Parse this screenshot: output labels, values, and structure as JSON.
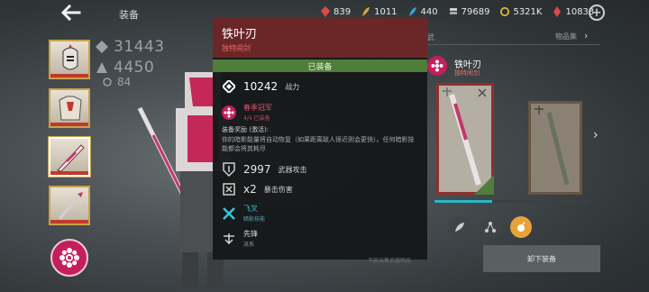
{
  "header": {
    "title": "装备",
    "currencies": [
      {
        "icon": "red-gem-icon",
        "color": "#e04848",
        "value": "839"
      },
      {
        "icon": "gold-feather-icon",
        "color": "#e0a33a",
        "value": "1011"
      },
      {
        "icon": "blue-feather-icon",
        "color": "#3aa0e0",
        "value": "440"
      },
      {
        "icon": "coin-stack-icon",
        "color": "#cfcfcf",
        "value": "79689"
      },
      {
        "icon": "gold-coin-icon",
        "color": "#e8c23a",
        "value": "5321K"
      },
      {
        "icon": "red-shard-icon",
        "color": "#e04848",
        "value": "10833"
      }
    ]
  },
  "left_stats": {
    "power": "31443",
    "rank": "4450",
    "level": "84"
  },
  "tooltip": {
    "name": "铁叶刃",
    "rarity": "独特闹剑",
    "equipped_label": "已装备",
    "power_value": "10242",
    "power_label": "战力",
    "season_name": "春季冠军",
    "season_sub": "4/4 已装备",
    "bonus_title": "装备奖励 (激活):",
    "bonus_text": "你的暗影能量将自动恢复（如果距离敌人很近则会更快）。任何暗影技能都会将其耗尽",
    "attack_value": "2997",
    "attack_label": "武器攻击",
    "crit_value": "x2",
    "crit_label": "暴击伤害",
    "skill_name": "飞叉",
    "skill_sub": "暗影技能",
    "lead_name": "先锋",
    "lead_sub": "派系"
  },
  "right_panel": {
    "tab_left": "武",
    "tab_right": "物品集",
    "item_name": "铁叶刃",
    "item_rarity": "独特闹剑",
    "unequip_label": "卸下装备",
    "footer_hint": "不能出售武器物品"
  },
  "ghost_power": "10242",
  "colors": {
    "tooltip_header": "#6b2727",
    "equipped_green": "#4f7d3a",
    "accent_cyan": "#27b8c9",
    "rarity_red": "#e86b6b"
  }
}
